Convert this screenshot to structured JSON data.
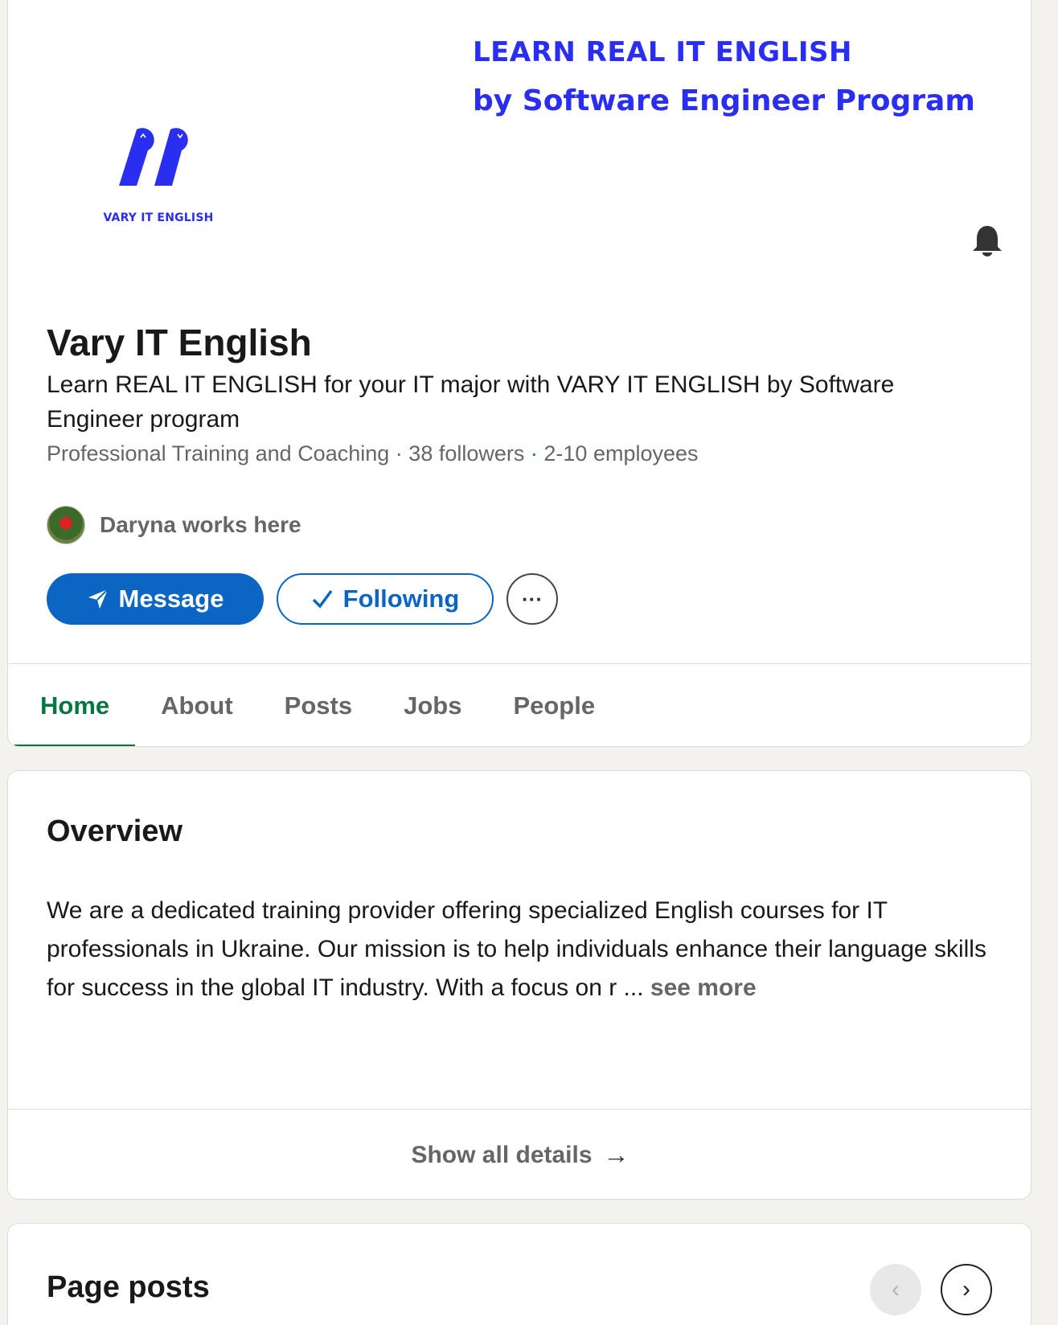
{
  "banner": {
    "line1": "LEARN REAL IT ENGLISH",
    "line2": "by Software Engineer Program",
    "logo_caption": "VARY IT ENGLISH",
    "brand_color": "#2a2ef0"
  },
  "company": {
    "name": "Vary IT English",
    "tagline": "Learn REAL IT ENGLISH for your IT major with VARY IT ENGLISH by Software Engineer program",
    "industry": "Professional Training and Coaching",
    "followers": "38 followers",
    "employees": "2-10 employees",
    "separator": "·"
  },
  "connection": {
    "text": "Daryna works here"
  },
  "actions": {
    "message_label": "Message",
    "following_label": "Following",
    "more_label": "···"
  },
  "tabs": [
    {
      "label": "Home",
      "active": true
    },
    {
      "label": "About",
      "active": false
    },
    {
      "label": "Posts",
      "active": false
    },
    {
      "label": "Jobs",
      "active": false
    },
    {
      "label": "People",
      "active": false
    }
  ],
  "overview": {
    "title": "Overview",
    "text": "We are a dedicated training provider offering specialized English courses for IT professionals in Ukraine. Our mission is to help individuals enhance their language skills for success in the global IT industry. With a focus on r ...",
    "see_more": "see more",
    "show_all": "Show all details",
    "show_all_arrow": "→"
  },
  "page_posts": {
    "title": "Page posts",
    "prev_icon": "‹",
    "next_icon": "›"
  },
  "colors": {
    "accent_blue": "#0a66c2",
    "active_tab_green": "#057642",
    "muted_text": "#666666"
  }
}
